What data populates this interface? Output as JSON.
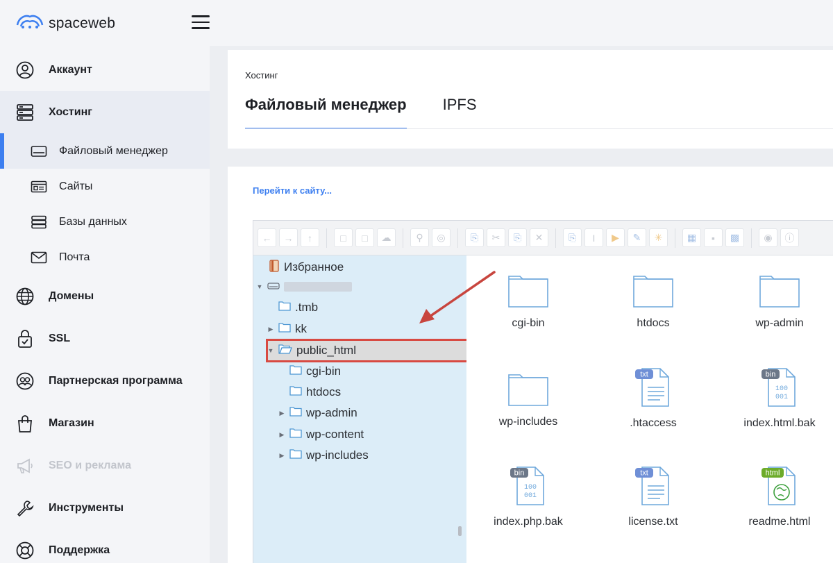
{
  "app": {
    "logo_text": "spaceweb"
  },
  "sidebar": {
    "items": [
      {
        "label": "Аккаунт",
        "icon": "user-icon"
      },
      {
        "label": "Хостинг",
        "icon": "server-icon"
      },
      {
        "label": "Домены",
        "icon": "globe-icon"
      },
      {
        "label": "SSL",
        "icon": "lock-icon"
      },
      {
        "label": "Партнерская программа",
        "icon": "partners-icon"
      },
      {
        "label": "Магазин",
        "icon": "shopping-bag-icon"
      },
      {
        "label": "SEO и реклама",
        "icon": "megaphone-icon"
      },
      {
        "label": "Инструменты",
        "icon": "wrench-icon"
      },
      {
        "label": "Поддержка",
        "icon": "lifebuoy-icon"
      }
    ],
    "hosting_sub": [
      {
        "label": "Файловый менеджер",
        "icon": "drive-icon"
      },
      {
        "label": "Сайты",
        "icon": "browser-icon"
      },
      {
        "label": "Базы данных",
        "icon": "database-icon"
      },
      {
        "label": "Почта",
        "icon": "mail-icon"
      }
    ]
  },
  "header": {
    "breadcrumb": "Хостинг",
    "tabs": [
      {
        "label": "Файловый менеджер"
      },
      {
        "label": "IPFS"
      }
    ]
  },
  "main": {
    "goto_link": "Перейти к сайту...",
    "tree": {
      "favorites": "Избранное",
      "nodes": [
        {
          "label": ".tmb"
        },
        {
          "label": "kk"
        },
        {
          "label": "public_html"
        },
        {
          "label": "cgi-bin"
        },
        {
          "label": "htdocs"
        },
        {
          "label": "wp-admin"
        },
        {
          "label": "wp-content"
        },
        {
          "label": "wp-includes"
        }
      ]
    },
    "files": [
      {
        "name": "cgi-bin",
        "type": "folder"
      },
      {
        "name": "htdocs",
        "type": "folder"
      },
      {
        "name": "wp-admin",
        "type": "folder"
      },
      {
        "name": "wp-includes",
        "type": "folder"
      },
      {
        "name": ".htaccess",
        "type": "txt",
        "badge": "txt"
      },
      {
        "name": "index.html.bak",
        "type": "bin",
        "badge": "bin"
      },
      {
        "name": "index.php.bak",
        "type": "bin",
        "badge": "bin"
      },
      {
        "name": "license.txt",
        "type": "txt",
        "badge": "txt"
      },
      {
        "name": "readme.html",
        "type": "html",
        "badge": "html"
      }
    ],
    "bin_glyph": {
      "line1": "100",
      "line2": "001"
    }
  },
  "colors": {
    "accent": "#3d7ff0",
    "highlight_border": "#d84a42",
    "tree_bg": "#dcedf8",
    "folder_stroke": "#6fa8dc",
    "txt_badge": "#6f8fd6",
    "bin_badge": "#6c7788",
    "html_badge": "#6cab2a"
  }
}
